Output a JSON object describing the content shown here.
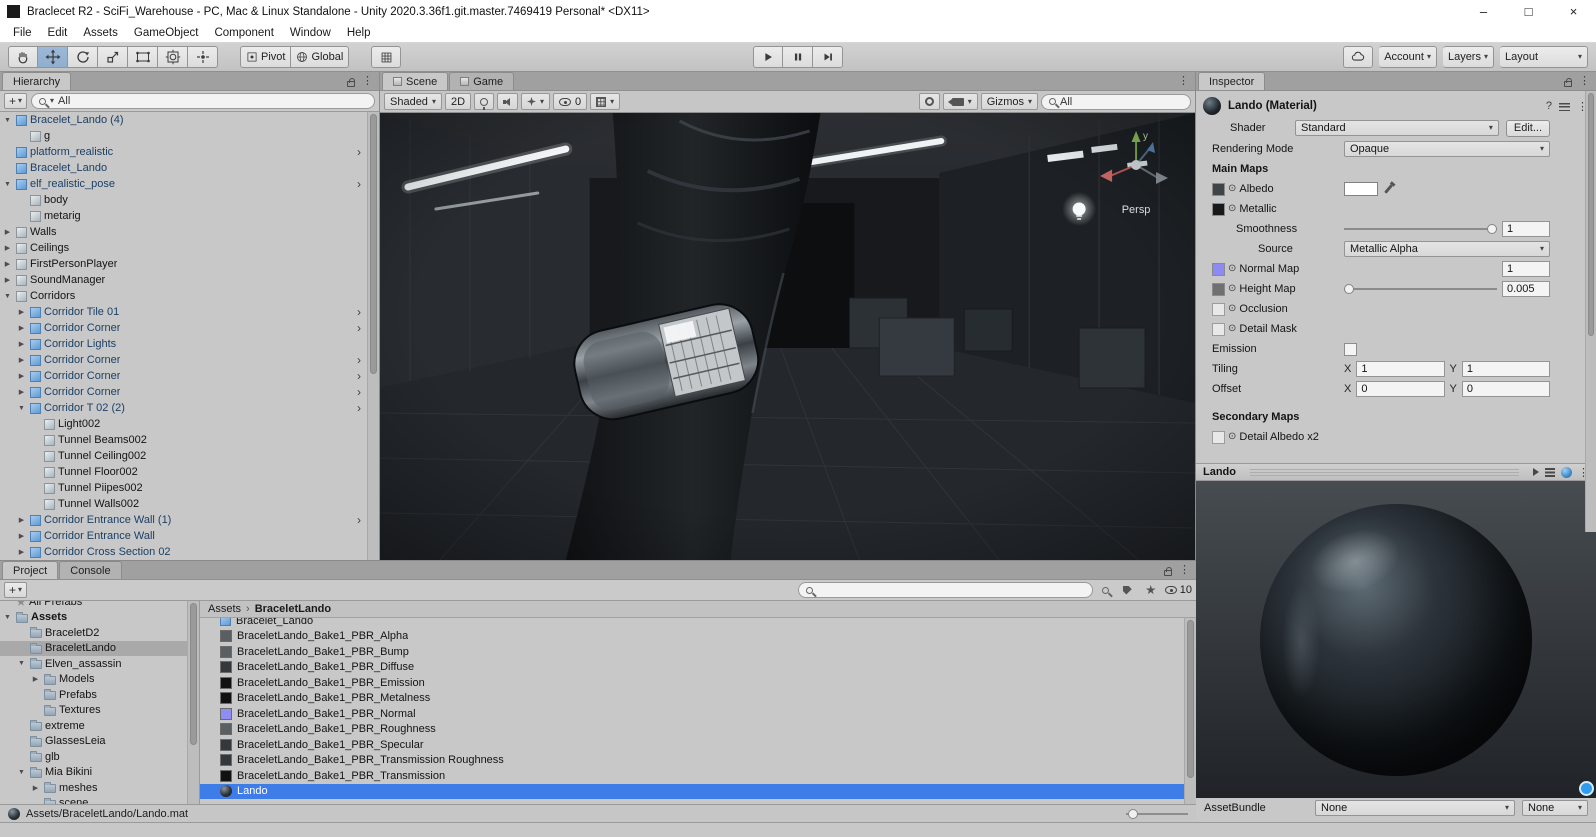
{
  "window": {
    "title": "Braclecet R2 - SciFi_Warehouse - PC, Mac & Linux Standalone - Unity 2020.3.36f1.git.master.7469419 Personal* <DX11>",
    "menus": [
      "File",
      "Edit",
      "Assets",
      "GameObject",
      "Component",
      "Window",
      "Help"
    ],
    "controls": {
      "minimize": "–",
      "maximize": "□",
      "close": "×"
    }
  },
  "icons": {
    "dropdown_arrow": "▾",
    "expander_open": "▼",
    "expander_closed": "▶",
    "nav_arrow": "›",
    "more": "⋮",
    "picker": "⊙",
    "breadcrumb_sep": "›",
    "help": "?",
    "plus": "+"
  },
  "toolbar": {
    "tools": [
      {
        "name": "hand-tool",
        "active": false
      },
      {
        "name": "move-tool",
        "active": true
      },
      {
        "name": "rotate-tool",
        "active": false
      },
      {
        "name": "scale-tool",
        "active": false
      },
      {
        "name": "rect-tool",
        "active": false
      },
      {
        "name": "transform-tool",
        "active": false
      },
      {
        "name": "custom-tool",
        "active": false
      }
    ],
    "pivot_label": "Pivot",
    "global_label": "Global",
    "account_label": "Account",
    "layers_label": "Layers",
    "layout_label": "Layout"
  },
  "hierarchy": {
    "tab_label": "Hierarchy",
    "search_value": "All",
    "items": [
      {
        "label": "Bracelet_Lando (4)",
        "depth": 1,
        "icon": "prefab",
        "expand": "open",
        "nav": false
      },
      {
        "label": "g",
        "depth": 2,
        "icon": "go",
        "expand": "none",
        "nav": false
      },
      {
        "label": "platform_realistic",
        "depth": 1,
        "icon": "prefab",
        "expand": "none",
        "nav": true
      },
      {
        "label": "Bracelet_Lando",
        "depth": 1,
        "icon": "prefab",
        "expand": "none",
        "nav": false
      },
      {
        "label": "elf_realistic_pose",
        "depth": 1,
        "icon": "prefab",
        "expand": "open",
        "nav": true
      },
      {
        "label": "body",
        "depth": 2,
        "icon": "go",
        "expand": "none",
        "nav": false
      },
      {
        "label": "metarig",
        "depth": 2,
        "icon": "go",
        "expand": "none",
        "nav": false
      },
      {
        "label": "Walls",
        "depth": 1,
        "icon": "go",
        "expand": "closed",
        "nav": false
      },
      {
        "label": "Ceilings",
        "depth": 1,
        "icon": "go",
        "expand": "closed",
        "nav": false
      },
      {
        "label": "FirstPersonPlayer",
        "depth": 1,
        "icon": "go",
        "expand": "closed",
        "nav": false
      },
      {
        "label": "SoundManager",
        "depth": 1,
        "icon": "go",
        "expand": "closed",
        "nav": false
      },
      {
        "label": "Corridors",
        "depth": 1,
        "icon": "go",
        "expand": "open",
        "nav": false
      },
      {
        "label": "Corridor Tile 01",
        "depth": 2,
        "icon": "prefab",
        "expand": "closed",
        "nav": true
      },
      {
        "label": "Corridor Corner",
        "depth": 2,
        "icon": "prefab",
        "expand": "closed",
        "nav": true
      },
      {
        "label": "Corridor Lights",
        "depth": 2,
        "icon": "prefab",
        "expand": "closed",
        "nav": false
      },
      {
        "label": "Corridor Corner",
        "depth": 2,
        "icon": "prefab",
        "expand": "closed",
        "nav": true
      },
      {
        "label": "Corridor Corner",
        "depth": 2,
        "icon": "prefab",
        "expand": "closed",
        "nav": true
      },
      {
        "label": "Corridor Corner",
        "depth": 2,
        "icon": "prefab",
        "expand": "closed",
        "nav": true
      },
      {
        "label": "Corridor T 02 (2)",
        "depth": 2,
        "icon": "prefab",
        "expand": "open",
        "nav": true
      },
      {
        "label": "Light002",
        "depth": 3,
        "icon": "go",
        "expand": "none",
        "nav": false
      },
      {
        "label": "Tunnel Beams002",
        "depth": 3,
        "icon": "go",
        "expand": "none",
        "nav": false
      },
      {
        "label": "Tunnel Ceiling002",
        "depth": 3,
        "icon": "go",
        "expand": "none",
        "nav": false
      },
      {
        "label": "Tunnel Floor002",
        "depth": 3,
        "icon": "go",
        "expand": "none",
        "nav": false
      },
      {
        "label": "Tunnel Piipes002",
        "depth": 3,
        "icon": "go",
        "expand": "none",
        "nav": false
      },
      {
        "label": "Tunnel Walls002",
        "depth": 3,
        "icon": "go",
        "expand": "none",
        "nav": false
      },
      {
        "label": "Corridor Entrance Wall (1)",
        "depth": 2,
        "icon": "prefab",
        "expand": "closed",
        "nav": true
      },
      {
        "label": "Corridor Entrance Wall",
        "depth": 2,
        "icon": "prefab",
        "expand": "closed",
        "nav": false
      },
      {
        "label": "Corridor Cross Section 02",
        "depth": 2,
        "icon": "prefab",
        "expand": "closed",
        "nav": false
      }
    ]
  },
  "scene": {
    "tab_scene": "Scene",
    "tab_game": "Game",
    "toolbar": {
      "shaded_label": "Shaded",
      "toggle_2d": "2D",
      "eye_count": "0",
      "gizmos_label": "Gizmos",
      "search_value": "All"
    },
    "overlay": {
      "persp_label": "Persp",
      "axis_y_label": "y"
    }
  },
  "inspector": {
    "tab_label": "Inspector",
    "material_name": "Lando (Material)",
    "shader_label": "Shader",
    "shader_value": "Standard",
    "edit_button": "Edit...",
    "properties": {
      "rendering_mode_label": "Rendering Mode",
      "rendering_mode_value": "Opaque",
      "main_maps_label": "Main Maps",
      "albedo_label": "Albedo",
      "metallic_label": "Metallic",
      "smoothness_label": "Smoothness",
      "smoothness_value": "1",
      "source_label": "Source",
      "source_value": "Metallic Alpha",
      "normal_map_label": "Normal Map",
      "normal_map_value": "1",
      "height_map_label": "Height Map",
      "height_map_value": "0.005",
      "occlusion_label": "Occlusion",
      "detail_mask_label": "Detail Mask",
      "emission_label": "Emission",
      "tiling_label": "Tiling",
      "tiling_x": "1",
      "tiling_y": "1",
      "offset_label": "Offset",
      "offset_x": "0",
      "offset_y": "0",
      "secondary_maps_label": "Secondary Maps",
      "detail_albedo_label": "Detail Albedo x2",
      "x_label": "X",
      "y_label": "Y"
    },
    "preview_title": "Lando",
    "assetbundle": {
      "label": "AssetBundle",
      "value1": "None",
      "value2": "None"
    }
  },
  "project": {
    "tab_project": "Project",
    "tab_console": "Console",
    "search_value": "",
    "eye_count": "10",
    "breadcrumb": [
      "Assets",
      "BraceletLando"
    ],
    "tree": [
      {
        "label": "All Prefabs",
        "depth": 1,
        "icon": "star",
        "expand": "none"
      },
      {
        "label": "Assets",
        "depth": 1,
        "icon": "folder",
        "expand": "open",
        "bold": true
      },
      {
        "label": "BraceletD2",
        "depth": 2,
        "icon": "folder",
        "expand": "none"
      },
      {
        "label": "BraceletLando",
        "depth": 2,
        "icon": "folder",
        "expand": "none",
        "selected": true
      },
      {
        "label": "Elven_assassin",
        "depth": 2,
        "icon": "folder",
        "expand": "open"
      },
      {
        "label": "Models",
        "depth": 3,
        "icon": "folder",
        "expand": "closed"
      },
      {
        "label": "Prefabs",
        "depth": 3,
        "icon": "folder",
        "expand": "none"
      },
      {
        "label": "Textures",
        "depth": 3,
        "icon": "folder",
        "expand": "none"
      },
      {
        "label": "extreme",
        "depth": 2,
        "icon": "folder",
        "expand": "none"
      },
      {
        "label": "GlassesLeia",
        "depth": 2,
        "icon": "folder",
        "expand": "none"
      },
      {
        "label": "glb",
        "depth": 2,
        "icon": "folder",
        "expand": "none"
      },
      {
        "label": "Mia Bikini",
        "depth": 2,
        "icon": "folder",
        "expand": "open"
      },
      {
        "label": "meshes",
        "depth": 3,
        "icon": "folder",
        "expand": "closed"
      },
      {
        "label": "scene",
        "depth": 3,
        "icon": "folder",
        "expand": "none"
      }
    ],
    "assets": [
      {
        "label": "Bracelet_Lando",
        "icon": "prefab"
      },
      {
        "label": "BraceletLando_Bake1_PBR_Alpha",
        "icon": "tex-gray"
      },
      {
        "label": "BraceletLando_Bake1_PBR_Bump",
        "icon": "tex-gray"
      },
      {
        "label": "BraceletLando_Bake1_PBR_Diffuse",
        "icon": "tex-dark"
      },
      {
        "label": "BraceletLando_Bake1_PBR_Emission",
        "icon": "tex-black"
      },
      {
        "label": "BraceletLando_Bake1_PBR_Metalness",
        "icon": "tex-black"
      },
      {
        "label": "BraceletLando_Bake1_PBR_Normal",
        "icon": "tex-normal"
      },
      {
        "label": "BraceletLando_Bake1_PBR_Roughness",
        "icon": "tex-gray"
      },
      {
        "label": "BraceletLando_Bake1_PBR_Specular",
        "icon": "tex-dark"
      },
      {
        "label": "BraceletLando_Bake1_PBR_Transmission Roughness",
        "icon": "tex-dark"
      },
      {
        "label": "BraceletLando_Bake1_PBR_Transmission",
        "icon": "tex-black"
      },
      {
        "label": "Lando",
        "icon": "material",
        "selected": true
      }
    ],
    "footer_path": "Assets/BraceletLando/Lando.mat"
  },
  "colors": {
    "selection_blue": "#3e7de7",
    "selection_gray": "#a9a9a9",
    "normal_map_purple": "#8b8bf3",
    "prefab_blue": "#5e9ad4"
  }
}
